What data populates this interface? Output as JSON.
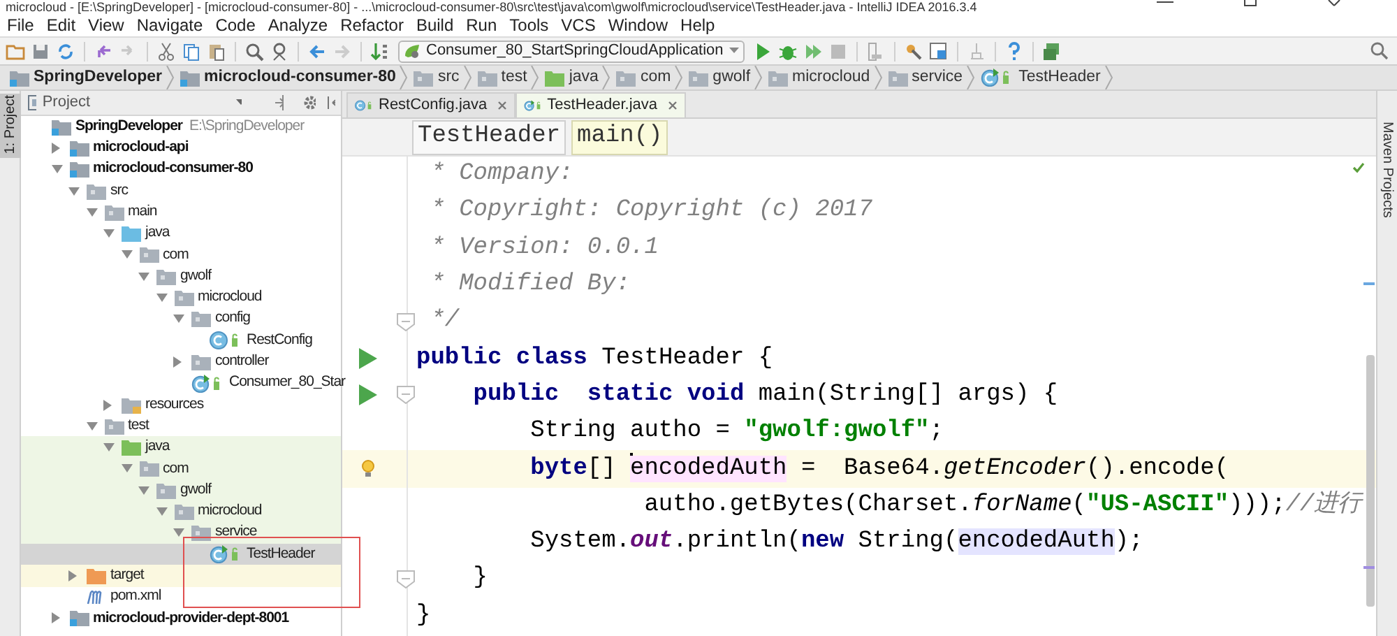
{
  "window": {
    "title": "microcloud - [E:\\SpringDeveloper] - [microcloud-consumer-80] - ...\\microcloud-consumer-80\\src\\test\\java\\com\\gwolf\\microcloud\\service\\TestHeader.java - IntelliJ IDEA 2016.3.4"
  },
  "menu": [
    "File",
    "Edit",
    "View",
    "Navigate",
    "Code",
    "Analyze",
    "Refactor",
    "Build",
    "Run",
    "Tools",
    "VCS",
    "Window",
    "Help"
  ],
  "toolbar": {
    "run_config": "Consumer_80_StartSpringCloudApplication"
  },
  "nav_bar": [
    {
      "label": "SpringDeveloper",
      "kind": "module"
    },
    {
      "label": "microcloud-consumer-80",
      "kind": "module"
    },
    {
      "label": "src",
      "kind": "folder"
    },
    {
      "label": "test",
      "kind": "folder"
    },
    {
      "label": "java",
      "kind": "test-root"
    },
    {
      "label": "com",
      "kind": "folder"
    },
    {
      "label": "gwolf",
      "kind": "folder"
    },
    {
      "label": "microcloud",
      "kind": "folder"
    },
    {
      "label": "service",
      "kind": "folder"
    },
    {
      "label": "TestHeader",
      "kind": "runnable-class"
    }
  ],
  "left_strip": {
    "label": "1: Project",
    "selected": true
  },
  "project_panel": {
    "title": "Project",
    "tree": [
      {
        "label": "SpringDeveloper",
        "path": "E:\\SpringDeveloper",
        "kind": "module",
        "selected": false,
        "children": [
          {
            "label": "microcloud-api",
            "kind": "module",
            "expanded": false,
            "selected": false
          },
          {
            "label": "microcloud-consumer-80",
            "kind": "module",
            "expanded": true,
            "selected": false,
            "children": [
              {
                "label": "src",
                "kind": "folder",
                "expanded": true,
                "selected": false,
                "children": [
                  {
                    "label": "main",
                    "kind": "folder",
                    "expanded": true,
                    "selected": false,
                    "children": [
                      {
                        "label": "java",
                        "kind": "source-root",
                        "expanded": true,
                        "selected": false,
                        "children": [
                          {
                            "label": "com",
                            "kind": "folder",
                            "expanded": true,
                            "selected": false,
                            "children": [
                              {
                                "label": "gwolf",
                                "kind": "folder",
                                "expanded": true,
                                "selected": false,
                                "children": [
                                  {
                                    "label": "microcloud",
                                    "kind": "folder",
                                    "expanded": true,
                                    "selected": false,
                                    "children": [
                                      {
                                        "label": "config",
                                        "kind": "folder",
                                        "expanded": true,
                                        "selected": false,
                                        "children": [
                                          {
                                            "label": "RestConfig",
                                            "kind": "class",
                                            "selected": false
                                          }
                                        ]
                                      },
                                      {
                                        "label": "controller",
                                        "kind": "folder",
                                        "expanded": false,
                                        "selected": false
                                      },
                                      {
                                        "label": "Consumer_80_Star",
                                        "kind": "runnable-class",
                                        "selected": false
                                      }
                                    ]
                                  }
                                ]
                              }
                            ]
                          }
                        ]
                      },
                      {
                        "label": "resources",
                        "kind": "resources-root",
                        "expanded": false,
                        "selected": false
                      }
                    ]
                  },
                  {
                    "label": "test",
                    "kind": "folder",
                    "expanded": true,
                    "selected": false,
                    "children": [
                      {
                        "label": "java",
                        "kind": "test-root",
                        "expanded": true,
                        "selected": false,
                        "children": [
                          {
                            "label": "com",
                            "kind": "folder",
                            "expanded": true,
                            "selected": false,
                            "children": [
                              {
                                "label": "gwolf",
                                "kind": "folder",
                                "expanded": true,
                                "selected": false,
                                "children": [
                                  {
                                    "label": "microcloud",
                                    "kind": "folder",
                                    "expanded": true,
                                    "selected": false,
                                    "children": [
                                      {
                                        "label": "service",
                                        "kind": "folder",
                                        "expanded": true,
                                        "selected": false,
                                        "children": [
                                          {
                                            "label": "TestHeader",
                                            "kind": "runnable-class",
                                            "selected": true
                                          }
                                        ]
                                      }
                                    ]
                                  }
                                ]
                              }
                            ]
                          }
                        ]
                      }
                    ]
                  }
                ]
              },
              {
                "label": "target",
                "kind": "excluded",
                "expanded": false,
                "selected": false
              },
              {
                "label": "pom.xml",
                "kind": "maven",
                "selected": false
              }
            ]
          },
          {
            "label": "microcloud-provider-dept-8001",
            "kind": "module",
            "expanded": false,
            "selected": false
          }
        ]
      }
    ]
  },
  "editor": {
    "tabs": [
      {
        "label": "RestConfig.java",
        "kind": "class",
        "selected": false
      },
      {
        "label": "TestHeader.java",
        "kind": "runnable-class",
        "selected": true
      }
    ],
    "breadcrumb": [
      {
        "label": "TestHeader",
        "selected": false
      },
      {
        "label": "main()",
        "selected": true
      }
    ],
    "lines": [
      {
        "tokens": [
          {
            "text": " * Company:",
            "kind": "comment"
          }
        ],
        "run_icon": false,
        "lightbulb": false,
        "fold": false,
        "current": false
      },
      {
        "tokens": [
          {
            "text": " * Copyright: Copyright (c) 2017",
            "kind": "comment"
          }
        ],
        "run_icon": false,
        "lightbulb": false,
        "fold": false,
        "current": false
      },
      {
        "tokens": [
          {
            "text": " * Version: 0.0.1",
            "kind": "comment"
          }
        ],
        "run_icon": false,
        "lightbulb": false,
        "fold": false,
        "current": false
      },
      {
        "tokens": [
          {
            "text": " * Modified By:",
            "kind": "comment"
          }
        ],
        "run_icon": false,
        "lightbulb": false,
        "fold": false,
        "current": false
      },
      {
        "tokens": [
          {
            "text": " */",
            "kind": "comment"
          }
        ],
        "run_icon": false,
        "lightbulb": false,
        "fold": true,
        "current": false
      },
      {
        "tokens": [
          {
            "text": "public",
            "kind": "keyword"
          },
          {
            "text": " class",
            "kind": "keyword"
          },
          {
            "text": " TestHeader {",
            "kind": "plain"
          }
        ],
        "run_icon": true,
        "lightbulb": false,
        "fold": false,
        "current": false
      },
      {
        "tokens": [
          {
            "text": "    public",
            "kind": "keyword"
          },
          {
            "text": "  static",
            "kind": "keyword"
          },
          {
            "text": " void",
            "kind": "keyword"
          },
          {
            "text": " main(String[] args) {",
            "kind": "plain"
          }
        ],
        "run_icon": true,
        "lightbulb": false,
        "fold": true,
        "current": false
      },
      {
        "tokens": [
          {
            "text": "        String autho = ",
            "kind": "plain"
          },
          {
            "text": "\"gwolf:gwolf\"",
            "kind": "string"
          },
          {
            "text": ";",
            "kind": "plain"
          }
        ],
        "run_icon": false,
        "lightbulb": false,
        "fold": false,
        "current": false
      },
      {
        "tokens": [
          {
            "text": "        byte",
            "kind": "keyword"
          },
          {
            "text": "[] ",
            "kind": "plain"
          },
          {
            "text": "encodedAuth",
            "kind": "write-usage"
          },
          {
            "text": " =  Base64.",
            "kind": "plain"
          },
          {
            "text": "getEncoder",
            "kind": "static-method"
          },
          {
            "text": "().encode(",
            "kind": "plain"
          }
        ],
        "run_icon": false,
        "lightbulb": true,
        "fold": false,
        "current": true
      },
      {
        "tokens": [
          {
            "text": "                autho.getBytes(Charset.",
            "kind": "plain"
          },
          {
            "text": "forName",
            "kind": "static-method"
          },
          {
            "text": "(",
            "kind": "plain"
          },
          {
            "text": "\"US-ASCII\"",
            "kind": "string"
          },
          {
            "text": ")));",
            "kind": "plain"
          },
          {
            "text": "//进行",
            "kind": "comment"
          }
        ],
        "run_icon": false,
        "lightbulb": false,
        "fold": false,
        "current": false
      },
      {
        "tokens": [
          {
            "text": "        System.",
            "kind": "plain"
          },
          {
            "text": "out",
            "kind": "static-field"
          },
          {
            "text": ".println(",
            "kind": "plain"
          },
          {
            "text": "new",
            "kind": "keyword"
          },
          {
            "text": " String(",
            "kind": "plain"
          },
          {
            "text": "encodedAuth",
            "kind": "read-usage"
          },
          {
            "text": ");",
            "kind": "plain"
          }
        ],
        "run_icon": false,
        "lightbulb": false,
        "fold": false,
        "current": false
      },
      {
        "tokens": [
          {
            "text": "    }",
            "kind": "plain"
          }
        ],
        "run_icon": false,
        "lightbulb": false,
        "fold": true,
        "current": false
      },
      {
        "tokens": [
          {
            "text": "}",
            "kind": "plain"
          }
        ],
        "run_icon": false,
        "lightbulb": false,
        "fold": false,
        "current": false
      }
    ]
  },
  "right_strip": {
    "label": "Maven Projects"
  }
}
